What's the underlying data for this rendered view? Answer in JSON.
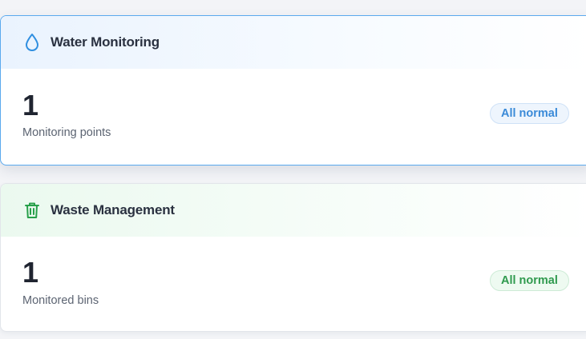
{
  "cards": [
    {
      "title": "Water Monitoring",
      "icon": "water-drop-icon",
      "value": "1",
      "label": "Monitoring points",
      "status": "All normal",
      "accent": "#3a8ad8"
    },
    {
      "title": "Waste Management",
      "icon": "trash-bin-icon",
      "value": "1",
      "label": "Monitored bins",
      "status": "All normal",
      "accent": "#2f9a4e"
    }
  ]
}
